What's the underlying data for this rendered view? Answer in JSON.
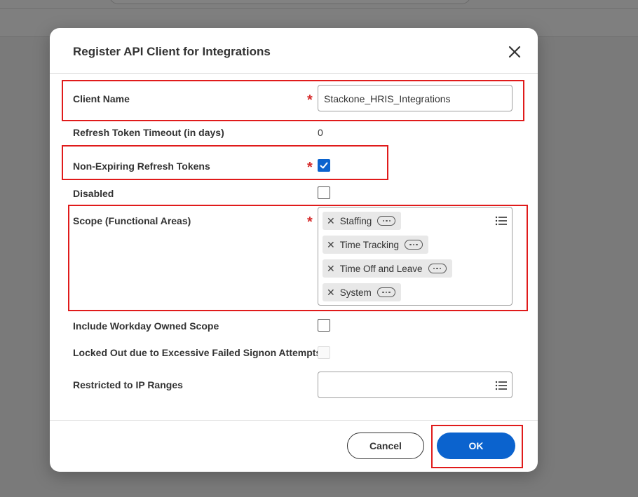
{
  "dialog": {
    "title": "Register API Client for Integrations",
    "close_icon": "close-icon"
  },
  "fields": {
    "client_name": {
      "label": "Client Name",
      "required": "*",
      "value": "Stackone_HRIS_Integrations"
    },
    "refresh_timeout": {
      "label": "Refresh Token Timeout (in days)",
      "value": "0"
    },
    "non_expiring": {
      "label": "Non-Expiring Refresh Tokens",
      "required": "*",
      "checked": true
    },
    "disabled": {
      "label": "Disabled",
      "checked": false
    },
    "scope": {
      "label": "Scope (Functional Areas)",
      "required": "*",
      "items": [
        "Staffing",
        "Time Tracking",
        "Time Off and Leave",
        "System"
      ],
      "remove_icon": "close-icon",
      "more_icon": "more-options-icon",
      "prompt_icon": "list-icon"
    },
    "include_owned": {
      "label": "Include Workday Owned Scope",
      "checked": false
    },
    "locked_out": {
      "label": "Locked Out due to Excessive Failed Signon Attempts",
      "checked": false,
      "disabled": true
    },
    "ip_ranges": {
      "label": "Restricted to IP Ranges",
      "value": "",
      "prompt_icon": "list-icon"
    }
  },
  "buttons": {
    "cancel": "Cancel",
    "ok": "OK"
  },
  "colors": {
    "accent": "#0b63ce",
    "required": "#d62b2b",
    "highlight": "#e01b1b",
    "overlay": "#7a7a7a"
  }
}
